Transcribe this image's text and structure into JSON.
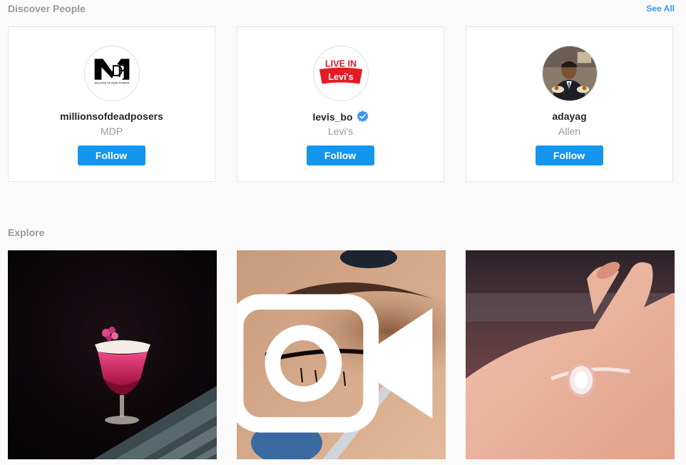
{
  "discover": {
    "title": "Discover People",
    "see_all": "See All",
    "people": [
      {
        "username": "millionsofdeadposers",
        "full_name": "MDP",
        "verified": false,
        "follow_label": "Follow",
        "avatar_text": "MILLIONS OF DEAD POSERS"
      },
      {
        "username": "levis_bo",
        "full_name": "Levi's",
        "verified": true,
        "follow_label": "Follow",
        "avatar_line1": "LIVE IN",
        "avatar_line2": "Levi's"
      },
      {
        "username": "adayag",
        "full_name": "Allen",
        "verified": false,
        "follow_label": "Follow"
      }
    ]
  },
  "explore": {
    "title": "Explore",
    "tiles": [
      {
        "kind": "image",
        "subject": "pink cocktail"
      },
      {
        "kind": "video",
        "subject": "eyeliner makeup",
        "icon": "video-camera-icon"
      },
      {
        "kind": "image",
        "subject": "engagement ring"
      }
    ]
  },
  "colors": {
    "accent": "#3897f0",
    "button": "#1495ee",
    "muted_text": "#999999",
    "background": "#fafafa"
  }
}
